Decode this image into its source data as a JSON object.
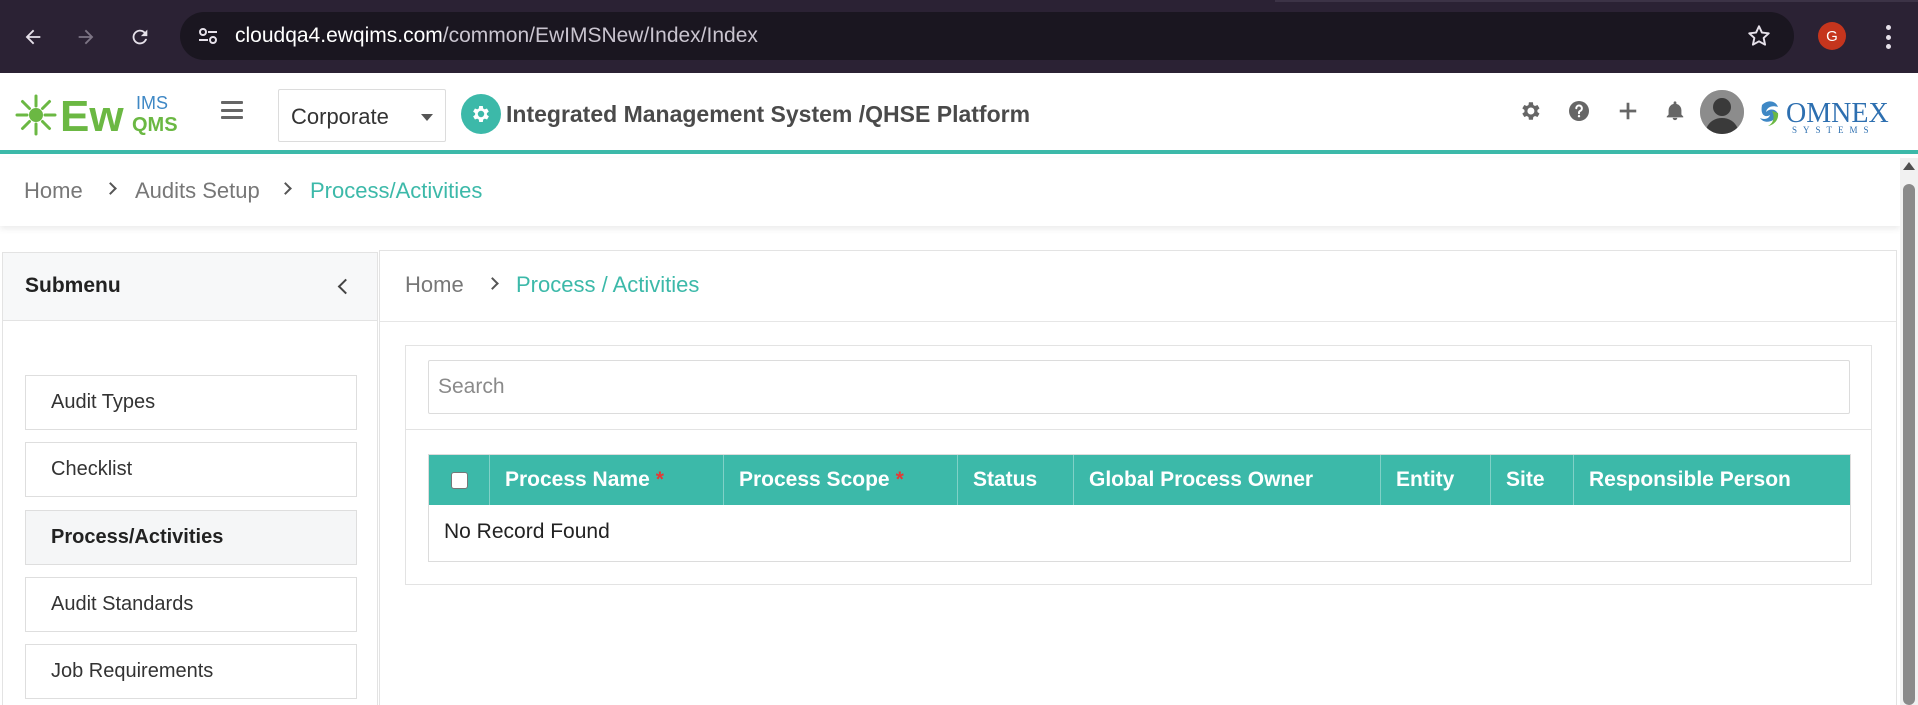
{
  "browser": {
    "url_host": "cloudqa4.ewqims.com",
    "url_path": "/common/EwIMSNew/Index/Index",
    "profile_initial": "G"
  },
  "header": {
    "logo_main": "Ew",
    "logo_top": "IMS",
    "logo_bottom": "QMS",
    "corporate_value": "Corporate",
    "platform_title": "Integrated Management System /QHSE Platform",
    "brand_name": "OMNEX",
    "brand_sub": "SYSTEMS"
  },
  "breadcrumb": {
    "items": [
      "Home",
      "Audits Setup",
      "Process/Activities"
    ]
  },
  "submenu": {
    "title": "Submenu",
    "items": [
      {
        "label": "Audit Types"
      },
      {
        "label": "Checklist"
      },
      {
        "label": "Process/Activities"
      },
      {
        "label": "Audit Standards"
      },
      {
        "label": "Job Requirements"
      }
    ],
    "active_index": 2
  },
  "main": {
    "breadcrumb": [
      "Home",
      "Process / Activities"
    ],
    "search_placeholder": "Search",
    "columns": [
      {
        "label": "Process Name",
        "required": "*"
      },
      {
        "label": "Process Scope",
        "required": "*"
      },
      {
        "label": "Status"
      },
      {
        "label": "Global Process Owner"
      },
      {
        "label": "Entity"
      },
      {
        "label": "Site"
      },
      {
        "label": "Responsible Person"
      }
    ],
    "empty_text": "No Record Found"
  },
  "colors": {
    "accent": "#3cb9a9",
    "required": "#e53935",
    "browser_bg": "#2b2234"
  }
}
